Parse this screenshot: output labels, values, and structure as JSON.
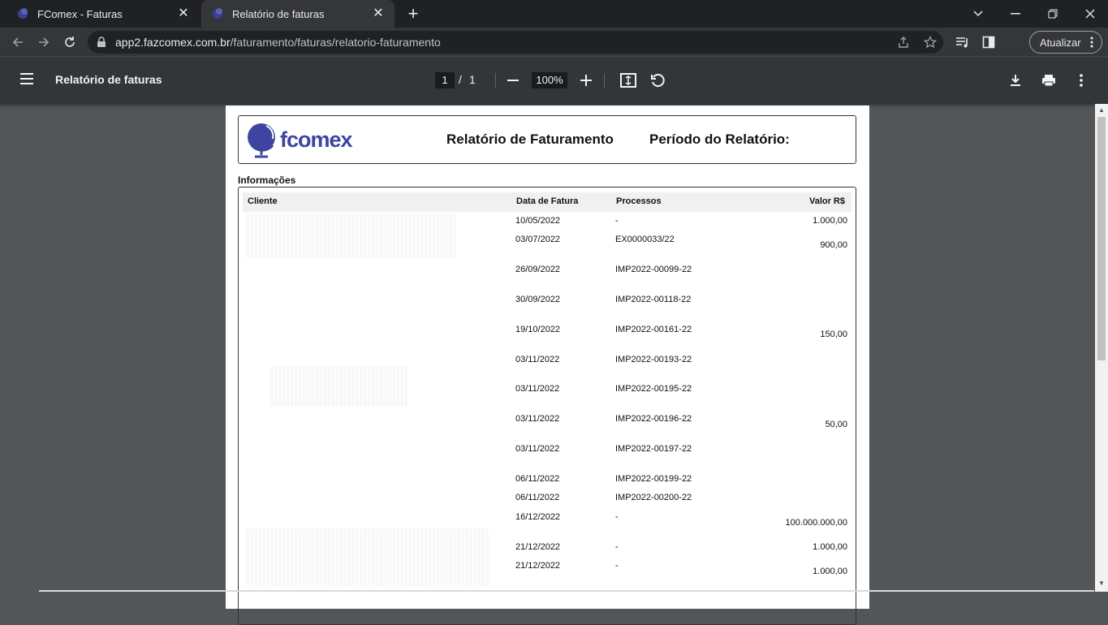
{
  "browser": {
    "tabs": [
      {
        "title": "FComex - Faturas",
        "active": false
      },
      {
        "title": "Relatório de faturas",
        "active": true
      }
    ],
    "url_host": "app2.fazcomex.com.br",
    "url_path": "/faturamento/faturas/relatorio-faturamento",
    "update_label": "Atualizar"
  },
  "viewer": {
    "title": "Relatório de faturas",
    "page_current": "1",
    "page_separator": "/",
    "page_total": "1",
    "zoom": "100%"
  },
  "report": {
    "logo_text": "fcomex",
    "title": "Relatório de Faturamento",
    "period_label": "Período do Relatório:",
    "section": "Informações",
    "columns": {
      "client": "Cliente",
      "date": "Data de Fatura",
      "process": "Processos",
      "value": "Valor R$"
    },
    "rows": [
      {
        "date": "10/05/2022",
        "process": "-",
        "value": "1.000,00"
      },
      {
        "date": "03/07/2022",
        "process": "EX0000033/22",
        "value": "900,00"
      },
      {
        "date": "26/09/2022",
        "process": "IMP2022-00099-22",
        "value": ""
      },
      {
        "date": "30/09/2022",
        "process": "IMP2022-00118-22",
        "value": ""
      },
      {
        "date": "19/10/2022",
        "process": "IMP2022-00161-22",
        "value": "150,00"
      },
      {
        "date": "03/11/2022",
        "process": "IMP2022-00193-22",
        "value": ""
      },
      {
        "date": "03/11/2022",
        "process": "IMP2022-00195-22",
        "value": ""
      },
      {
        "date": "03/11/2022",
        "process": "IMP2022-00196-22",
        "value": "50,00"
      },
      {
        "date": "03/11/2022",
        "process": "IMP2022-00197-22",
        "value": ""
      },
      {
        "date": "06/11/2022",
        "process": "IMP2022-00199-22",
        "value": ""
      },
      {
        "date": "06/11/2022",
        "process": "IMP2022-00200-22",
        "value": ""
      },
      {
        "date": "16/12/2022",
        "process": "-",
        "value": "100.000.000,00"
      },
      {
        "date": "21/12/2022",
        "process": "-",
        "value": "1.000,00"
      },
      {
        "date": "21/12/2022",
        "process": "-",
        "value": "1.000,00"
      }
    ]
  },
  "colors": {
    "brand": "#3d45a0",
    "chrome_dark": "#202124",
    "viewer_bg": "#525659"
  }
}
